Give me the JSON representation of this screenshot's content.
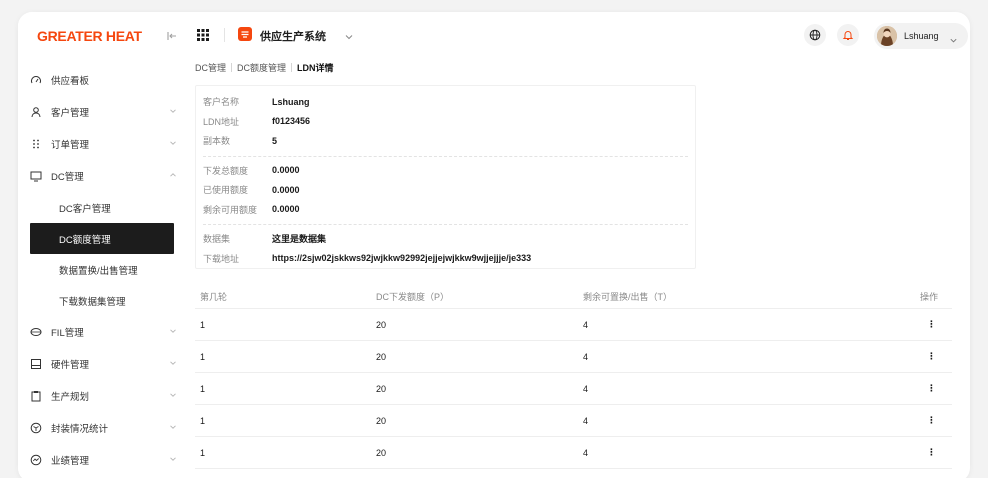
{
  "logo": "GREATER HEAT",
  "sidebar": {
    "items": [
      {
        "label": "供应看板",
        "icon": "gauge-icon",
        "expandable": false
      },
      {
        "label": "客户管理",
        "icon": "user-icon",
        "expandable": true
      },
      {
        "label": "订单管理",
        "icon": "dots-grid-icon",
        "expandable": true
      },
      {
        "label": "DC管理",
        "icon": "monitor-icon",
        "expandable": true,
        "expanded": true,
        "children": [
          {
            "label": "DC客户管理"
          },
          {
            "label": "DC额度管理",
            "active": true
          },
          {
            "label": "数据置换/出售管理"
          },
          {
            "label": "下载数据集管理"
          }
        ]
      },
      {
        "label": "FIL管理",
        "icon": "coin-icon",
        "expandable": true
      },
      {
        "label": "硬件管理",
        "icon": "server-icon",
        "expandable": true
      },
      {
        "label": "生产规划",
        "icon": "clipboard-icon",
        "expandable": true
      },
      {
        "label": "封装情况统计",
        "icon": "package-icon",
        "expandable": true
      },
      {
        "label": "业绩管理",
        "icon": "chart-circle-icon",
        "expandable": true
      }
    ]
  },
  "topbar": {
    "app_title": "供应生产系统",
    "user_name": "Lshuang"
  },
  "breadcrumb": [
    "DC管理",
    "DC额度管理",
    "LDN详情"
  ],
  "detail": {
    "group1": [
      {
        "label": "客户名称",
        "value": "Lshuang"
      },
      {
        "label": "LDN地址",
        "value": "f0123456"
      },
      {
        "label": "副本数",
        "value": "5"
      }
    ],
    "group2": [
      {
        "label": "下发总额度",
        "value": "0.0000"
      },
      {
        "label": "已使用额度",
        "value": "0.0000"
      },
      {
        "label": "剩余可用额度",
        "value": "0.0000"
      }
    ],
    "group3": [
      {
        "label": "数据集",
        "value": "这里是数据集"
      },
      {
        "label": "下载地址",
        "value": "https://2sjw02jskkws92jwjkkw92992jejjejwjkkw9wjjejjje/je333"
      }
    ]
  },
  "table": {
    "headers": [
      "第几轮",
      "DC下发额度（P）",
      "剩余可置换/出售（T）",
      "操作"
    ],
    "rows": [
      [
        "1",
        "20",
        "4",
        "⋮"
      ],
      [
        "1",
        "20",
        "4",
        "⋮"
      ],
      [
        "1",
        "20",
        "4",
        "⋮"
      ],
      [
        "1",
        "20",
        "4",
        "⋮"
      ],
      [
        "1",
        "20",
        "4",
        "⋮"
      ]
    ]
  },
  "colors": {
    "accent": "#f5470f",
    "active_bg": "#1c1c1c"
  }
}
